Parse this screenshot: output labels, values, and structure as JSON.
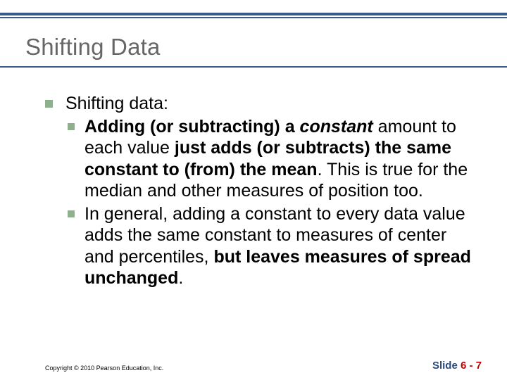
{
  "title": "Shifting Data",
  "bullet1": "Shifting data:",
  "sub1_a": "Adding (or subtracting) a ",
  "sub1_b": "constant",
  "sub1_c": " amount to each value ",
  "sub1_d": "just adds (or subtracts) the same constant to (from) the mean",
  "sub1_e": ". This is true for the median and other measures of position too.",
  "sub2_a": "In general, adding a constant to every data value adds the same constant to measures of center and percentiles, ",
  "sub2_b": "but leaves measures of spread unchanged",
  "sub2_c": ".",
  "copyright": "Copyright © 2010 Pearson Education, Inc.",
  "slide_label": "Slide ",
  "slide_num": "6 - 7"
}
